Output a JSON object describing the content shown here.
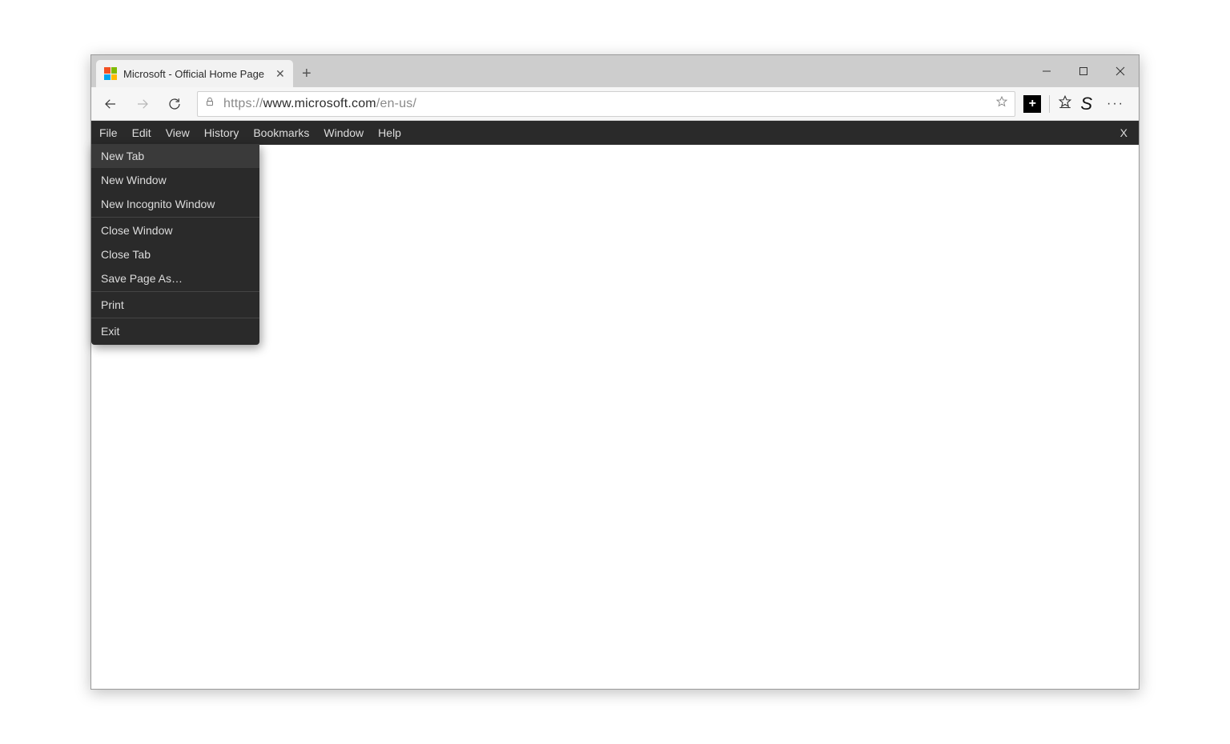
{
  "tab": {
    "title": "Microsoft - Official Home Page"
  },
  "toolbar": {
    "url_prefix": "https://",
    "url_main": "www.microsoft.com",
    "url_suffix": "/en-us/"
  },
  "right": {
    "ext_plus": "+",
    "s_ext": "S",
    "dots": "···"
  },
  "menubar": {
    "items": [
      "File",
      "Edit",
      "View",
      "History",
      "Bookmarks",
      "Window",
      "Help"
    ],
    "close": "X"
  },
  "dropdown": {
    "group1": [
      "New Tab",
      "New Window",
      "New Incognito Window"
    ],
    "group2": [
      "Close Window",
      "Close Tab",
      "Save Page As…"
    ],
    "group3": [
      "Print"
    ],
    "group4": [
      "Exit"
    ]
  }
}
